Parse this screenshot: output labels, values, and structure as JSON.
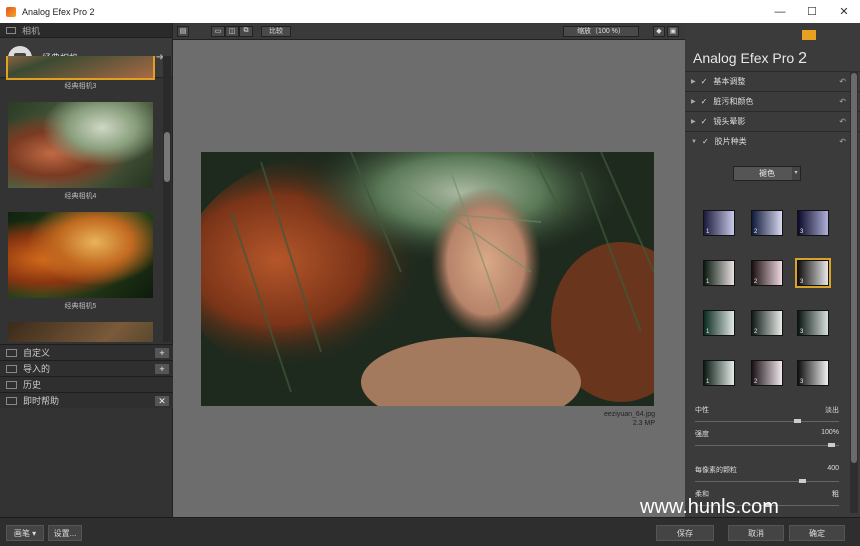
{
  "window": {
    "title": "Analog Efex Pro 2",
    "buttons": [
      "—",
      "☐",
      "✕"
    ]
  },
  "left": {
    "header": "相机",
    "category": "经典相机",
    "thumbs": [
      {
        "caption": "经典相机3"
      },
      {
        "caption": "经典相机4"
      },
      {
        "caption": "经典相机5"
      }
    ],
    "sections": [
      {
        "label": "自定义",
        "action": "+"
      },
      {
        "label": "导入的",
        "action": "+"
      },
      {
        "label": "历史",
        "action": ""
      },
      {
        "label": "即时帮助",
        "action": "✕"
      }
    ]
  },
  "toolbar": {
    "compare": "比较",
    "zoom": "缩放（100 %）"
  },
  "image": {
    "filename": "eeziyuan_64.jpg",
    "size": "2.3 MP"
  },
  "right": {
    "app_name": "Analog Efex Pro",
    "app_version": "2",
    "sections": [
      "基本调整",
      "脏污和颜色",
      "镜头晕影",
      "胶片种类"
    ],
    "film_dropdown": "褪色",
    "swatch_numbers": [
      "1",
      "2",
      "3",
      "1",
      "2",
      "3",
      "1",
      "2",
      "3",
      "1",
      "2",
      "3"
    ],
    "selected_swatch": 6,
    "sliders": [
      {
        "label": "中性",
        "value": "淡出",
        "level": 0.72
      },
      {
        "label": "强度",
        "value": "100%",
        "level": 0.97
      },
      {
        "label": "每像素的颗粒",
        "value": "400",
        "level": 0.76
      },
      {
        "label": "柔和",
        "value": "粗",
        "level": 0.5
      }
    ]
  },
  "bottom": {
    "brush": "画笔",
    "settings": "设置...",
    "save": "保存",
    "cancel": "取消",
    "ok": "确定"
  },
  "watermark": "www.hunls.com"
}
